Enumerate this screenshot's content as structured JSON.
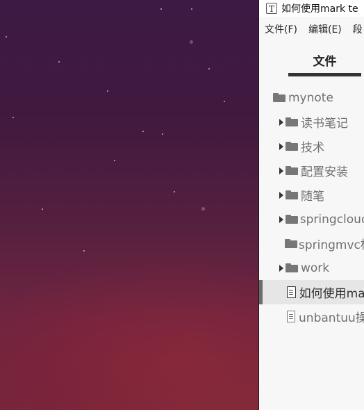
{
  "window": {
    "title": "如何使用mark te",
    "app_icon_glyph": "T"
  },
  "menu": {
    "items": [
      "文件(F)",
      "编辑(E)",
      "段"
    ]
  },
  "sidebar": {
    "active_tab": "文件",
    "tree": {
      "root": "mynote",
      "items": [
        {
          "label": "读书笔记",
          "type": "folder",
          "expandable": true
        },
        {
          "label": "技术",
          "type": "folder",
          "expandable": true
        },
        {
          "label": "配置安装",
          "type": "folder",
          "expandable": true
        },
        {
          "label": "随笔",
          "type": "folder",
          "expandable": true
        },
        {
          "label": "springcloud",
          "type": "folder",
          "expandable": true
        },
        {
          "label": "springmvc框",
          "type": "folder",
          "expandable": false
        },
        {
          "label": "work",
          "type": "folder",
          "expandable": true
        },
        {
          "label": "如何使用ma",
          "type": "file",
          "selected": true
        },
        {
          "label": "unbantuu操",
          "type": "file",
          "selected": false
        }
      ]
    }
  },
  "colors": {
    "sidebar_bg": "#f7f7f7",
    "selected_row_bg": "#e6e6e6",
    "icon_gray": "#777777"
  }
}
